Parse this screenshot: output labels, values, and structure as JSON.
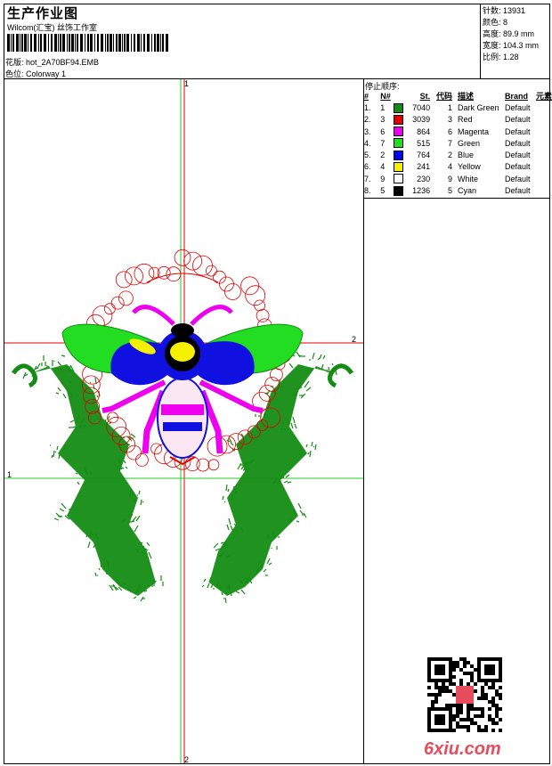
{
  "header": {
    "title": "生产作业图",
    "subtitle": "Wilcom(汇宝) 丝饰工作室",
    "file_label": "花版: hot_2A70BF94.EMB",
    "colorway_label": "色位:  Colorway 1"
  },
  "stats": {
    "stitches": "针数: 13931",
    "colors": "颜色: 8",
    "height": "高度: 89.9 mm",
    "width": "宽度: 104.3 mm",
    "ratio": "比例: 1.28"
  },
  "stop_sequence": {
    "title": "停止顺序:",
    "headers": [
      "#",
      "N#",
      "St.",
      "代码",
      "描述",
      "Brand",
      "元素"
    ],
    "rows": [
      {
        "idx": "1.",
        "n": "1",
        "color": "#148c14",
        "st": "7040",
        "code": "1",
        "desc": "Dark Green",
        "brand": "Default"
      },
      {
        "idx": "2.",
        "n": "3",
        "color": "#e00000",
        "st": "3039",
        "code": "3",
        "desc": "Red",
        "brand": "Default"
      },
      {
        "idx": "3.",
        "n": "6",
        "color": "#ee00ee",
        "st": "864",
        "code": "6",
        "desc": "Magenta",
        "brand": "Default"
      },
      {
        "idx": "4.",
        "n": "7",
        "color": "#22dd22",
        "st": "515",
        "code": "7",
        "desc": "Green",
        "brand": "Default"
      },
      {
        "idx": "5.",
        "n": "2",
        "color": "#0000ee",
        "st": "764",
        "code": "2",
        "desc": "Blue",
        "brand": "Default"
      },
      {
        "idx": "6.",
        "n": "4",
        "color": "#f5f000",
        "st": "241",
        "code": "4",
        "desc": "Yellow",
        "brand": "Default"
      },
      {
        "idx": "7.",
        "n": "9",
        "color": "#ffffff",
        "st": "230",
        "code": "9",
        "desc": "White",
        "brand": "Default"
      },
      {
        "idx": "8.",
        "n": "5",
        "color": "#000000",
        "st": "1236",
        "code": "5",
        "desc": "Cyan",
        "brand": "Default"
      }
    ]
  },
  "axes": {
    "label_1": "1",
    "label_2": "2"
  },
  "watermark": {
    "site": "6xiu.com"
  },
  "colors": {
    "crosshair_red": "#e00000",
    "crosshair_green": "#22cc22"
  }
}
